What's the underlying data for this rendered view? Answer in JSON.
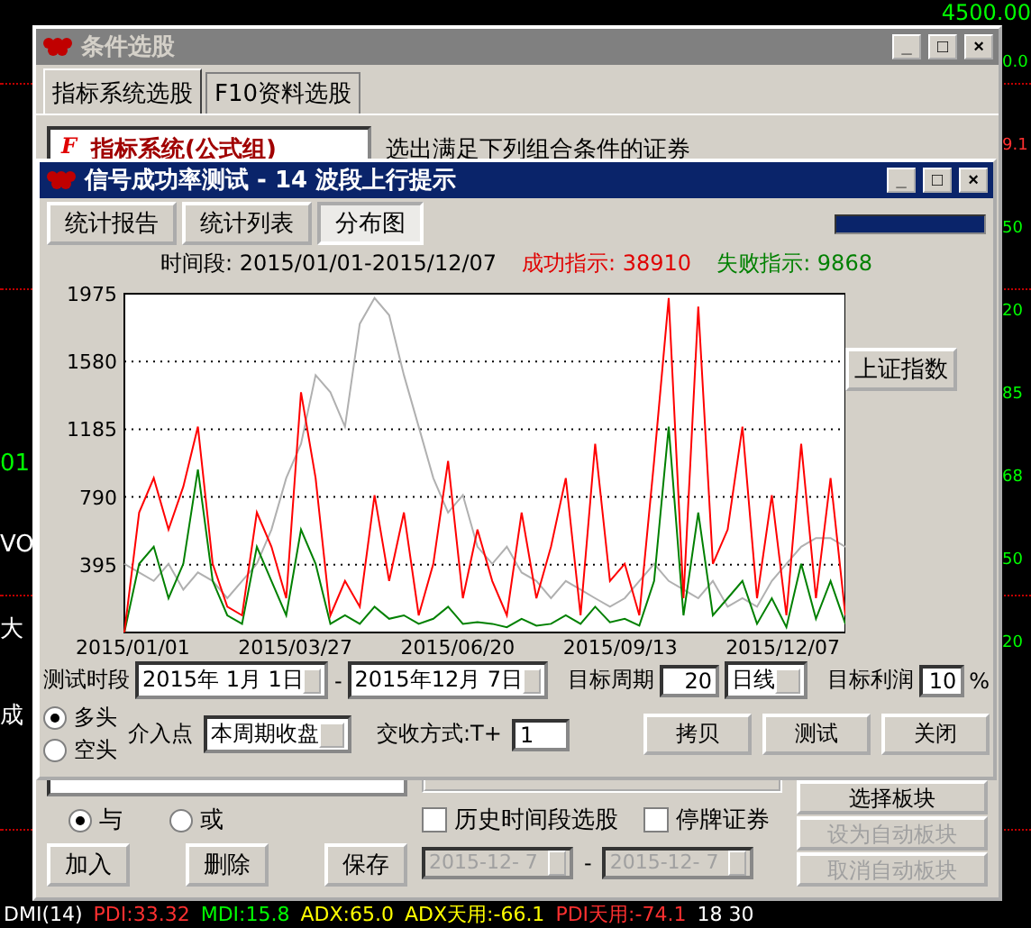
{
  "background_chart": {
    "top_label": "4500.00",
    "left_labels": [
      {
        "text": "01",
        "color": "#00ff00"
      },
      {
        "text": "VO",
        "color": "#ffffff"
      },
      {
        "text": "大",
        "color": "#ffffff"
      },
      {
        "text": "成",
        "color": "#ffffff"
      }
    ],
    "right_labels": [
      {
        "text": "0.0",
        "color": "#00ff00"
      },
      {
        "text": "9.1",
        "color": "#ff3030"
      },
      {
        "text": "50",
        "color": "#00ff00"
      },
      {
        "text": "20",
        "color": "#00ff00"
      },
      {
        "text": "85",
        "color": "#00ff00"
      },
      {
        "text": "68",
        "color": "#00ff00"
      },
      {
        "text": "50",
        "color": "#00ff00"
      },
      {
        "text": "20",
        "color": "#00ff00"
      }
    ],
    "status_bar": [
      {
        "text": "DMI(14)",
        "color": "#ffffff"
      },
      {
        "text": "PDI:33.32",
        "color": "#ff3030"
      },
      {
        "text": "MDI:15.8",
        "color": "#00ff00"
      },
      {
        "text": "ADX:65.0",
        "color": "#ffff00"
      },
      {
        "text": "ADX天用:-66.1",
        "color": "#ffff00"
      },
      {
        "text": "PDI天用:-74.1",
        "color": "#ff3030"
      },
      {
        "text": "18 30",
        "color": "#ffffff"
      }
    ]
  },
  "back_window": {
    "title": "条件选股",
    "controls": [
      "_",
      "□",
      "×"
    ],
    "tabs": [
      {
        "label": "指标系统选股",
        "selected": true
      },
      {
        "label": "F10资料选股",
        "selected": false
      }
    ],
    "tree_item": {
      "icon": "F",
      "label": "指标系统(公式组)"
    },
    "description": "选出满足下列组合条件的证券",
    "logic": [
      {
        "label": "与",
        "selected": true
      },
      {
        "label": "或",
        "selected": false
      }
    ],
    "list_buttons": [
      "加入",
      "删除",
      "保存"
    ],
    "checkboxes": [
      {
        "label": "历史时间段选股",
        "checked": false
      },
      {
        "label": "停牌证券",
        "checked": false
      }
    ],
    "date_from": "2015-12- 7",
    "date_separator": "-",
    "date_to": "2015-12- 7",
    "block_buttons": [
      {
        "label": "选择板块",
        "disabled": false
      },
      {
        "label": "设为自动板块",
        "disabled": true
      },
      {
        "label": "取消自动板块",
        "disabled": true
      }
    ]
  },
  "dialog": {
    "title": "信号成功率测试 - 14 波段上行提示",
    "controls": [
      "_",
      "□",
      "×"
    ],
    "view_buttons": [
      {
        "label": "统计报告",
        "selected": false
      },
      {
        "label": "统计列表",
        "selected": false
      },
      {
        "label": "分布图",
        "selected": true
      }
    ],
    "progress": {
      "level": 1
    },
    "period_label": "时间段: 2015/01/01-2015/12/07",
    "success_label": "成功指示: 38910",
    "fail_label": "失败指示: 9868",
    "index_button": "上证指数",
    "axis_dates": [
      "2015/01/01",
      "2015/03/27",
      "2015/06/20",
      "2015/09/13",
      "2015/12/07"
    ],
    "chart_data": {
      "type": "line",
      "ylim": [
        0,
        1975
      ],
      "yticks": [
        395,
        790,
        1185,
        1580,
        1975
      ],
      "grid": true,
      "series": [
        {
          "color": "#ff0000",
          "values": [
            0,
            700,
            900,
            600,
            850,
            1200,
            400,
            150,
            100,
            700,
            500,
            200,
            1400,
            900,
            100,
            300,
            150,
            800,
            300,
            700,
            100,
            400,
            1000,
            200,
            600,
            300,
            100,
            700,
            200,
            500,
            900,
            100,
            1100,
            300,
            400,
            100,
            1000,
            1950,
            200,
            1900,
            400,
            600,
            1200,
            200,
            800,
            100,
            1100,
            200,
            900,
            100
          ]
        },
        {
          "color": "#008000",
          "values": [
            0,
            400,
            500,
            200,
            400,
            950,
            300,
            100,
            50,
            500,
            300,
            100,
            600,
            400,
            50,
            100,
            50,
            150,
            80,
            100,
            50,
            80,
            150,
            50,
            60,
            50,
            30,
            80,
            40,
            50,
            100,
            50,
            150,
            60,
            80,
            40,
            300,
            1200,
            100,
            700,
            100,
            200,
            300,
            50,
            200,
            30,
            400,
            80,
            300,
            50
          ]
        },
        {
          "color": "#b0b0b0",
          "values": [
            400,
            350,
            300,
            400,
            250,
            350,
            300,
            200,
            300,
            400,
            600,
            900,
            1100,
            1500,
            1400,
            1200,
            1800,
            1950,
            1850,
            1500,
            1200,
            900,
            700,
            800,
            500,
            400,
            500,
            350,
            300,
            200,
            300,
            250,
            200,
            150,
            200,
            300,
            400,
            300,
            250,
            200,
            300,
            150,
            200,
            150,
            300,
            400,
            500,
            550,
            550,
            500
          ]
        }
      ]
    },
    "test_period_label": "测试时段",
    "start_date": "2015年 1月 1日",
    "range_separator": "-",
    "end_date": "2015年12月 7日",
    "target_period_label": "目标周期",
    "target_period": "20",
    "period_unit": "日线",
    "target_profit_label": "目标利润",
    "target_profit": "10",
    "percent": "%",
    "direction": [
      {
        "label": "多头",
        "selected": true
      },
      {
        "label": "空头",
        "selected": false
      }
    ],
    "entry_label": "介入点",
    "entry_point": "本周期收盘",
    "settlement_label": "交收方式:T+",
    "settlement": "1",
    "action_buttons": [
      "拷贝",
      "测试",
      "关闭"
    ]
  }
}
